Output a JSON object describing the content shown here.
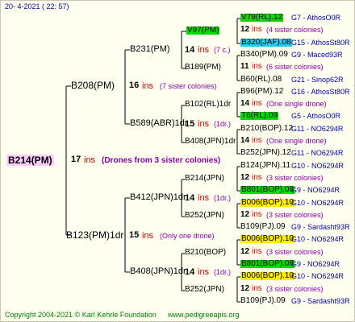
{
  "header": "20-   4-2021  ( 22: 57)",
  "footer": {
    "copyright": "Copyright 2004-2021 © Karl Kehrle Foundation",
    "site": "www.pedigreeapis.org"
  },
  "colors": {
    "root": "#ffccff",
    "green": "#00dd00",
    "cyan": "#22ccee",
    "yellow": "#ffee00",
    "ins": "#cc0000",
    "note": "#8800aa",
    "badge": "#0000aa"
  },
  "root": {
    "label": "B214(PM)",
    "count": "17",
    "ins": "ins",
    "note": "(Drones from 3 sister colonies)"
  },
  "gen1": [
    {
      "label": "B208(PM)",
      "count": "16",
      "ins": "ins",
      "note": "(7 sister colonies)"
    },
    {
      "label": "B123(PM)1dr",
      "count": "15",
      "ins": "ins",
      "note": "(Only one drone)"
    }
  ],
  "gen2": [
    {
      "label": "B231(PM)",
      "count": "14",
      "ins": "ins",
      "note": "(7 c.)"
    },
    {
      "label": "B589(ABR)1dr",
      "count": "15",
      "ins": "ins",
      "note": "(1dr.)"
    },
    {
      "label": "B412(JPN)1dr",
      "count": "14",
      "ins": "ins",
      "note": "(1dr.)"
    },
    {
      "label": "B408(JPN)1dr",
      "count": "14",
      "ins": "ins",
      "note": "(1dr.)"
    }
  ],
  "gen3": [
    {
      "label": "V97(PM)",
      "count": "",
      "ins": "",
      "note": ""
    },
    {
      "label": "B189(PM)",
      "count": "",
      "ins": "",
      "note": ""
    },
    {
      "label": "B102(RL)1dr",
      "count": "",
      "ins": "",
      "note": ""
    },
    {
      "label": "B408(JPN)1dr",
      "count": "",
      "ins": "",
      "note": ""
    },
    {
      "label": "B214(JPN)",
      "count": "",
      "ins": "",
      "note": ""
    },
    {
      "label": "B252(JPN)",
      "count": "",
      "ins": "",
      "note": ""
    },
    {
      "label": "B210(BOP)",
      "count": "",
      "ins": "",
      "note": ""
    },
    {
      "label": "B252(JPN)",
      "count": "",
      "ins": "",
      "note": ""
    }
  ],
  "leaves": [
    {
      "label": "V79(RL).12",
      "badge": "G7 - AthosO0R"
    },
    {
      "count": "12",
      "ins": "ins",
      "note": "(4 sister colonies)"
    },
    {
      "label": "B320(JAF).08",
      "badge": "G15 - AthosSt80R"
    },
    {
      "label": "B340(PM).09",
      "badge": "G9 - Maced93R"
    },
    {
      "count": "11",
      "ins": "ins",
      "note": "(6 sister colonies)"
    },
    {
      "label": "B60(RL).08",
      "badge": "G21 - Sinop62R"
    },
    {
      "label": "B96(PM).12",
      "badge": "G16 - AthosSt80R"
    },
    {
      "count": "14",
      "ins": "ins",
      "note": "(One single drone)"
    },
    {
      "label": "T6(RL).09",
      "badge": "G5 - AthosO0R"
    },
    {
      "label": "B210(BOP).12",
      "badge": "G11 - NO6294R"
    },
    {
      "count": "14",
      "ins": "ins",
      "note": "(One single drone)"
    },
    {
      "label": "B252(JPN).12",
      "badge": "G11 - NO6294R"
    },
    {
      "label": "B124(JPN).11",
      "badge": "G10 - NO6294R"
    },
    {
      "count": "12",
      "ins": "ins",
      "note": "(3 sister colonies)"
    },
    {
      "label": "B801(BOP).08",
      "badge": "G9 - NO6294R"
    },
    {
      "label": "B006(BOP).10",
      "badge": "G10 - NO6294R"
    },
    {
      "count": "12",
      "ins": "ins",
      "note": "(3 sister colonies)"
    },
    {
      "label": "B109(PJ).09",
      "badge": "G9 - Sardasht93R"
    },
    {
      "label": "B006(BOP).10",
      "badge": "G10 - NO6294R"
    },
    {
      "count": "12",
      "ins": "ins",
      "note": "(3 sister colonies)"
    },
    {
      "label": "B801(BOP).08",
      "badge": "G9 - NO6294R"
    },
    {
      "label": "B006(BOP).10",
      "badge": "G10 - NO6294R"
    },
    {
      "count": "12",
      "ins": "ins",
      "note": "(3 sister colonies)"
    },
    {
      "label": "B109(PJ).09",
      "badge": "G9 - Sardasht93R"
    }
  ]
}
